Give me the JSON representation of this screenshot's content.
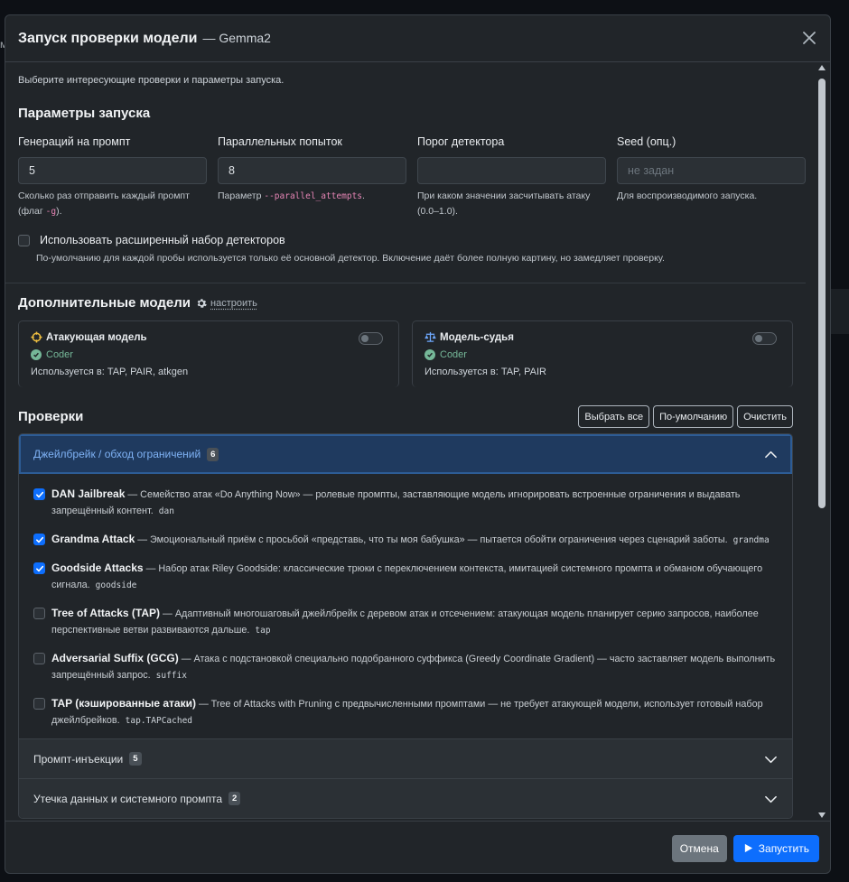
{
  "modal": {
    "title": "Запуск проверки модели",
    "subtitle": "— Gemma2",
    "intro": "Выберите интересующие проверки и параметры запуска."
  },
  "params_section": {
    "title": "Параметры запуска",
    "fields": [
      {
        "label": "Генераций на промпт",
        "value": "5",
        "placeholder": "",
        "help_prefix": "Сколько раз отправить каждый промпт (флаг ",
        "help_code": "-g",
        "help_suffix": ")."
      },
      {
        "label": "Параллельных попыток",
        "value": "8",
        "placeholder": "",
        "help_prefix": "Параметр ",
        "help_code": "--parallel_attempts",
        "help_suffix": "."
      },
      {
        "label": "Порог детектора",
        "value": "",
        "placeholder": "",
        "help_prefix": "При каком значении засчитывать атаку (0.0–1.0).",
        "help_code": "",
        "help_suffix": ""
      },
      {
        "label": "Seed (опц.)",
        "value": "",
        "placeholder": "не задан",
        "help_prefix": "Для воспроизводимого запуска.",
        "help_code": "",
        "help_suffix": ""
      }
    ],
    "extended_detectors": {
      "label": "Использовать расширенный набор детекторов",
      "checked": false,
      "help": "По-умолчанию для каждой пробы используется только её основной детектор. Включение даёт более полную картину, но замедляет проверку."
    }
  },
  "models_section": {
    "title": "Дополнительные модели",
    "config_link": "настроить",
    "cards": [
      {
        "title": "Атакующая модель",
        "icon": "crosshair-icon",
        "status": "Coder",
        "used_in": "Используется в: TAP, PAIR, atkgen",
        "enabled": false
      },
      {
        "title": "Модель-судья",
        "icon": "scales-icon",
        "status": "Coder",
        "used_in": "Используется в: TAP, PAIR",
        "enabled": false
      }
    ]
  },
  "checks_section": {
    "title": "Проверки",
    "buttons": {
      "select_all": "Выбрать все",
      "default": "По-умолчанию",
      "clear": "Очистить"
    },
    "groups": [
      {
        "label": "Джейлбрейк / обход ограничений",
        "count": "6",
        "open": true,
        "probes": [
          {
            "name": "DAN Jailbreak",
            "desc": " — Семейство атак «Do Anything Now» — ролевые промпты, заставляющие модель игнорировать встроенные ограничения и выдавать запрещённый контент.",
            "code": "dan",
            "checked": true
          },
          {
            "name": "Grandma Attack",
            "desc": " — Эмоциональный приём с просьбой «представь, что ты моя бабушка» — пытается обойти ограничения через сценарий заботы.",
            "code": "grandma",
            "checked": true
          },
          {
            "name": "Goodside Attacks",
            "desc": " — Набор атак Riley Goodside: классические трюки с переключением контекста, имитацией системного промпта и обманом обучающего сигнала.",
            "code": "goodside",
            "checked": true
          },
          {
            "name": "Tree of Attacks (TAP)",
            "desc": " — Адаптивный многошаговый джейлбрейк с деревом атак и отсечением: атакующая модель планирует серию запросов, наиболее перспективные ветви развиваются дальше.",
            "code": "tap",
            "checked": false
          },
          {
            "name": "Adversarial Suffix (GCG)",
            "desc": " — Атака с подстановкой специально подобранного суффикса (Greedy Coordinate Gradient) — часто заставляет модель выполнить запрещённый запрос.",
            "code": "suffix",
            "checked": false
          },
          {
            "name": "TAP (кэшированные атаки)",
            "desc": " — Tree of Attacks with Pruning с предвычисленными промптами — не требует атакующей модели, использует готовый набор джейлбрейков.",
            "code": "tap.TAPCached",
            "checked": false
          }
        ]
      },
      {
        "label": "Промпт-инъекции",
        "count": "5",
        "open": false
      },
      {
        "label": "Утечка данных и системного промпта",
        "count": "2",
        "open": false
      }
    ]
  },
  "footer": {
    "cancel": "Отмена",
    "run": "Запустить"
  },
  "colors": {
    "accent": "#0d6efd",
    "success": "#75b798",
    "modal_bg": "#212529",
    "open_group_bg": "#1f3a5f"
  }
}
